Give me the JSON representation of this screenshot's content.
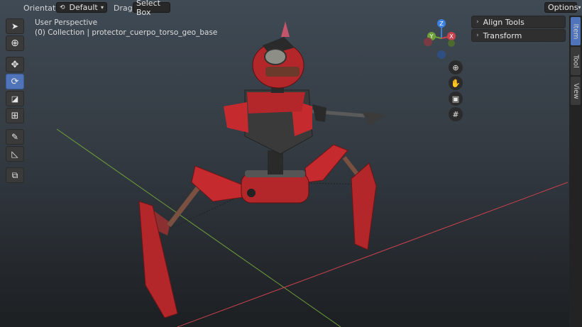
{
  "header": {
    "orientation_label": "Orientation:",
    "orientation_value": "Default",
    "drag_label": "Drag:",
    "drag_value": "Select Box",
    "options_label": "Options"
  },
  "viewport": {
    "perspective": "User Perspective",
    "collection": "(0) Collection | protector_cuerpo_torso_geo_base"
  },
  "gizmo": {
    "z": "Z",
    "y": "Y",
    "x": "X"
  },
  "npanel": {
    "align_tools": "Align Tools",
    "transform": "Transform"
  },
  "sidebar_tabs": [
    "Item",
    "Tool",
    "View"
  ],
  "tools": [
    "select-box",
    "cursor",
    "move",
    "rotate",
    "scale",
    "transform",
    "annotate",
    "measure",
    "add-cube"
  ],
  "nav_icons": [
    "zoom",
    "hand-pan",
    "camera",
    "grid"
  ],
  "colors": {
    "accent": "#4f74b9",
    "axis_x": "#c9424e",
    "axis_y": "#6fa03a",
    "axis_z": "#3b7fe0",
    "robot_red": "#b3262a"
  }
}
